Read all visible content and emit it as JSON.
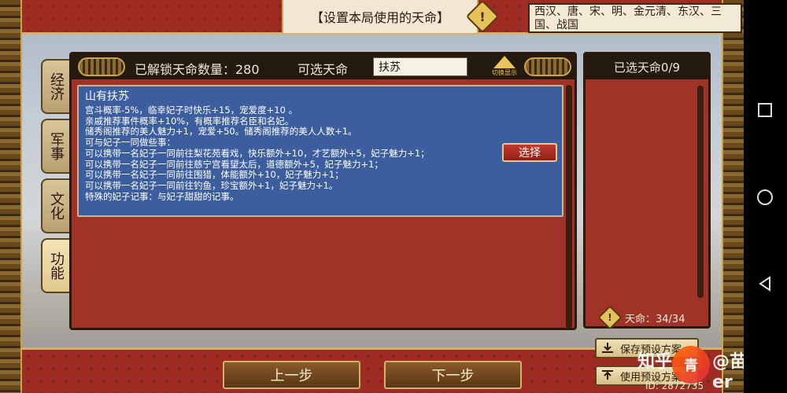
{
  "top": {
    "title": "【设置本局使用的天命】",
    "dynasties": "西汉、唐、宋、明、金元清、东汉、三国、战国",
    "warn_glyph": "!"
  },
  "side_tabs": [
    {
      "label": "经济"
    },
    {
      "label": "军事"
    },
    {
      "label": "文化"
    },
    {
      "label": "功能"
    }
  ],
  "main": {
    "unlocked_count": "已解锁天命数量：280",
    "optional_label": "可选天命",
    "search_value": "扶苏",
    "badge_caption": "切换显示",
    "card": {
      "title": "山有扶苏",
      "lines": [
        "宫斗概率-5%，临幸妃子时快乐+15，宠爱度+10 。",
        "亲戚推荐事件概率+10%，有概率推荐名臣和名妃。",
        "储秀阁推荐的美人魅力+1，宠爱+50。储秀阁推荐的美人人数+1。",
        "可与妃子一同做些事：",
        "可以携带一名妃子一同前往梨花苑看戏，快乐额外+10，才艺额外+5，妃子魅力+1；",
        "可以携带一名妃子一同前往慈宁宫看望太后，道德额外+5，妃子魅力+1；",
        "可以携带一名妃子一同前往围猎，体能额外+10，妃子魅力+1；",
        "可以携带一名妃子一同前往钓鱼，珍宝额外+1，妃子魅力+1。",
        "特殊的妃子记事：与妃子甜甜的记事。"
      ],
      "select_label": "选择"
    }
  },
  "right": {
    "header": "已选天命0/9",
    "tianming": "天命：34/34"
  },
  "bottom": {
    "prev_label": "上一步",
    "next_label": "下一步",
    "save_label": "保存预设方案",
    "use_label": "使用预设方案",
    "id_text": "ID: 2872735"
  },
  "watermark": {
    "left": "知乎",
    "logo": "青",
    "right": "@苗er"
  },
  "colors": {
    "panel_red": "#9f3327",
    "card_blue": "#3d5e9e",
    "header_dark": "#241a10",
    "gold": "#d3b36a"
  }
}
